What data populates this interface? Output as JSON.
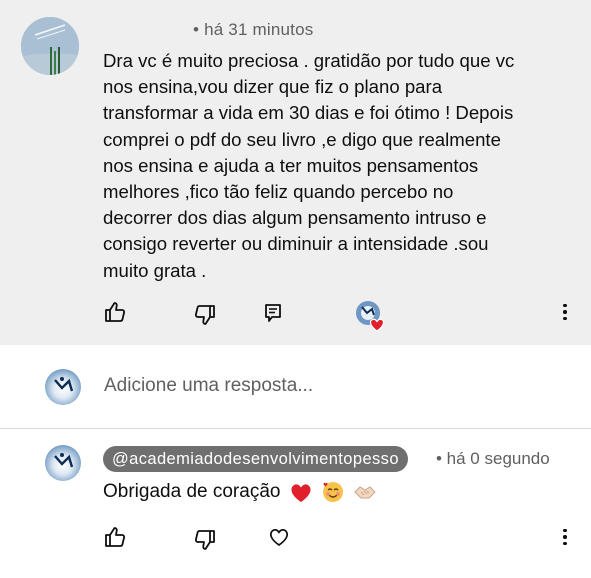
{
  "comment": {
    "meta": "• há 31 minutos",
    "text": "Dra vc é muito preciosa . gratidão por tudo que vc\nnos ensina,vou dizer que fiz o plano para\ntransformar a vida em 30 dias e foi ótimo ! Depois\ncomprei o pdf do seu livro ,e digo que realmente\nnos ensina e ajuda a ter muitos pensamentos\nmelhores ,fico tão feliz quando percebo no\ndecorrer dos dias algum pensamento intruso e\nconsigo reverter ou diminuir a intensidade .sou\nmuito grata .",
    "actions": [
      "like-icon",
      "dislike-icon",
      "reply-icon",
      "creator-heart-icon",
      "more-icon"
    ]
  },
  "reply_box": {
    "placeholder": "Adicione uma resposta..."
  },
  "reply": {
    "handle": "@academiadodesenvolvimentopesso",
    "meta": "• há 0 segundo",
    "text": "Obrigada de coração",
    "emojis": [
      "red-heart-emoji",
      "smiling-face-with-hearts-emoji",
      "handshake-emoji"
    ],
    "actions": [
      "like-icon",
      "dislike-icon",
      "heart-icon",
      "more-icon"
    ]
  },
  "colors": {
    "comment_background": "#efefef",
    "handle_pill": "#6f6f6f",
    "secondary_text": "#606060",
    "heart_red": "#e0202a"
  }
}
